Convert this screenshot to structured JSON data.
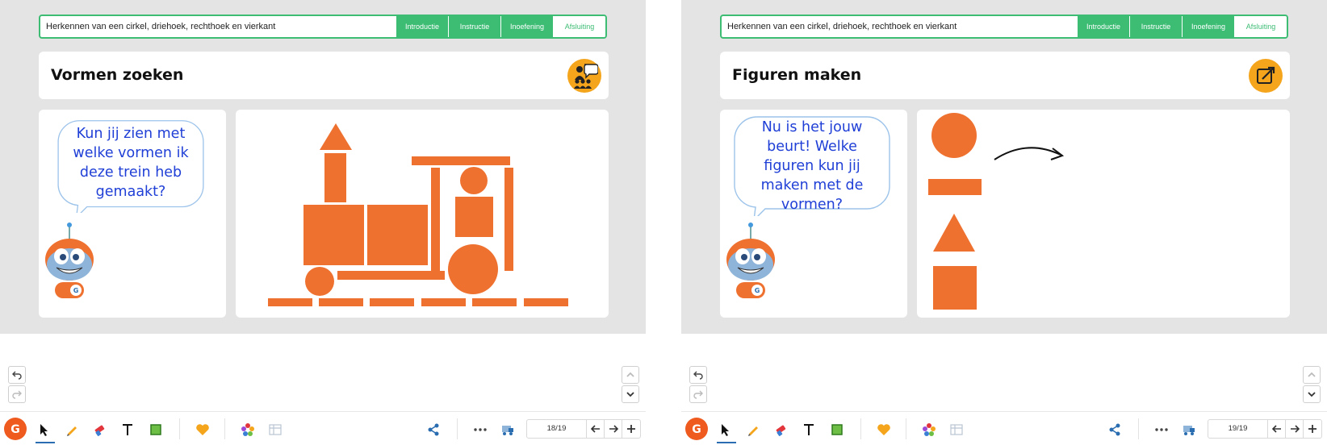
{
  "left": {
    "lesson_title": "Herkennen van een cirkel, driehoek, rechthoek en vierkant",
    "phases": [
      "Introductie",
      "Instructie",
      "Inoefening",
      "Afsluiting"
    ],
    "active_phase": "Afsluiting",
    "slide_title": "Vormen zoeken",
    "badge_icon": "group-discussion-icon",
    "bubble_lines": [
      "Kun jij zien met",
      "welke vormen ik",
      "deze trein heb",
      "gemaakt?"
    ],
    "page_count": "18/19"
  },
  "right": {
    "lesson_title": "Herkennen van een cirkel, driehoek, rechthoek en vierkant",
    "phases": [
      "Introductie",
      "Instructie",
      "Inoefening",
      "Afsluiting"
    ],
    "active_phase": "Afsluiting",
    "slide_title": "Figuren maken",
    "badge_icon": "edit-arrow-icon",
    "bubble_lines": [
      "Nu is het jouw",
      "beurt! Welke",
      "figuren kun jij",
      "maken met de",
      "vormen?"
    ],
    "page_count": "19/19"
  },
  "colors": {
    "accent_green": "#3dbc74",
    "shape_orange": "#ef7130",
    "badge_orange": "#f4a51c",
    "bubble_text": "#1f3fd6",
    "stage_gray": "#e4e4e4"
  },
  "toolbar_icons": [
    "undo-icon",
    "redo-icon",
    "logo-icon",
    "pointer-icon",
    "pencil-icon",
    "eraser-icon",
    "text-icon",
    "shape-icon",
    "heart-icon",
    "color-wheel-icon",
    "table-icon",
    "share-icon",
    "more-icon",
    "cart-icon",
    "prev-icon",
    "next-icon",
    "add-icon",
    "scroll-up-icon",
    "scroll-down-icon"
  ]
}
